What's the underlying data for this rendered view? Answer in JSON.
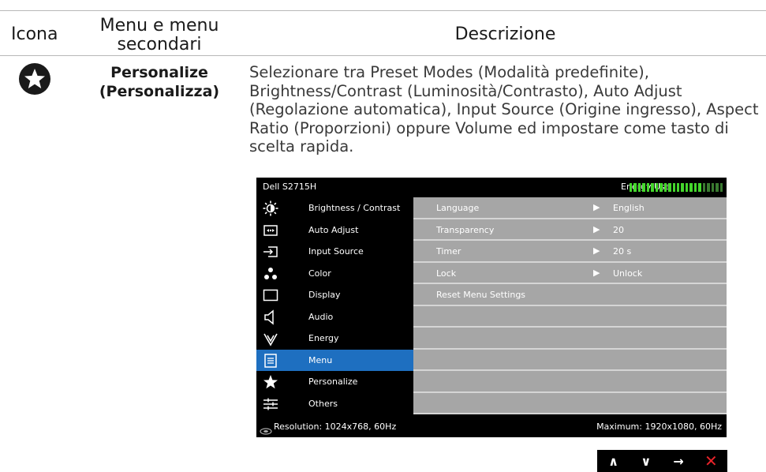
{
  "table": {
    "headers": {
      "icon": "Icona",
      "menu": "Menu e menu secondari",
      "description": "Descrizione"
    },
    "row": {
      "icon": "star-circle-icon",
      "name_line1": "Personalize",
      "name_line2": "(Personalizza)",
      "description": "Selezionare tra Preset Modes (Modalità predefinite), Brightness/Contrast (Luminosità/Contrasto), Auto Adjust (Regolazione automatica), Input Source (Origine ingresso), Aspect Ratio (Proporzioni) oppure Volume ed impostare come tasto di scelta rapida."
    }
  },
  "osd": {
    "title": "Dell S2715H",
    "energy_label": "Energy Use",
    "energy_level": 0.78,
    "colors": {
      "selected": "#1e6fc0",
      "energy_on": "#44d62c",
      "energy_off": "#3a7a30",
      "submenu_row": "#a6a6a6"
    },
    "menu_items": [
      {
        "label": "Brightness / Contrast",
        "icon": "brightness-icon",
        "selected": false
      },
      {
        "label": "Auto Adjust",
        "icon": "auto-adjust-icon",
        "selected": false
      },
      {
        "label": "Input Source",
        "icon": "input-source-icon",
        "selected": false
      },
      {
        "label": "Color",
        "icon": "color-icon",
        "selected": false
      },
      {
        "label": "Display",
        "icon": "display-icon",
        "selected": false
      },
      {
        "label": "Audio",
        "icon": "speaker-icon",
        "selected": false
      },
      {
        "label": "Energy",
        "icon": "energy-icon",
        "selected": false
      },
      {
        "label": "Menu",
        "icon": "menu-icon",
        "selected": true
      },
      {
        "label": "Personalize",
        "icon": "star-icon",
        "selected": false
      },
      {
        "label": "Others",
        "icon": "others-icon",
        "selected": false
      }
    ],
    "submenu": [
      {
        "key": "Language",
        "arrow": "▶",
        "value": "English"
      },
      {
        "key": "Transparency",
        "arrow": "▶",
        "value": "20"
      },
      {
        "key": "Timer",
        "arrow": "▶",
        "value": "20 s"
      },
      {
        "key": "Lock",
        "arrow": "▶",
        "value": "Unlock"
      },
      {
        "key": "Reset Menu Settings",
        "arrow": "",
        "value": ""
      },
      {
        "key": "",
        "arrow": "",
        "value": ""
      },
      {
        "key": "",
        "arrow": "",
        "value": ""
      },
      {
        "key": "",
        "arrow": "",
        "value": ""
      },
      {
        "key": "",
        "arrow": "",
        "value": ""
      },
      {
        "key": "",
        "arrow": "",
        "value": ""
      }
    ],
    "footer": {
      "resolution": "Resolution: 1024x768, 60Hz",
      "maximum": "Maximum: 1920x1080, 60Hz"
    }
  },
  "nav_buttons": [
    {
      "glyph": "∧",
      "icon": "up-icon"
    },
    {
      "glyph": "∨",
      "icon": "down-icon"
    },
    {
      "glyph": "→",
      "icon": "right-arrow-icon"
    },
    {
      "glyph": "✕",
      "icon": "close-icon"
    }
  ]
}
